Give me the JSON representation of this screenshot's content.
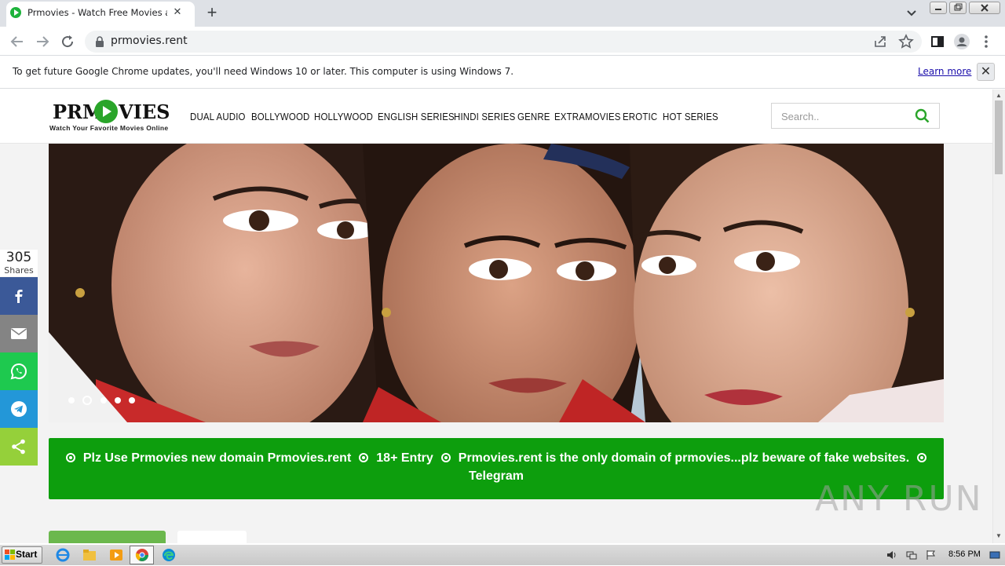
{
  "browser": {
    "tab_title": "Prmovies - Watch Free Movies and TV",
    "tab_close": "✕",
    "new_tab": "+",
    "url": "prmovies.rent",
    "infobar_text": "To get future Google Chrome updates, you'll need Windows 10 or later. This computer is using Windows 7.",
    "infobar_link": "Learn more",
    "infobar_close": "✕"
  },
  "site": {
    "logo_left": "PRM",
    "logo_right": "VIES",
    "tagline": "Watch Your Favorite Movies Online",
    "nav": [
      "DUAL AUDIO",
      "BOLLYWOOD",
      "HOLLYWOOD",
      "ENGLISH SERIES",
      "HINDI SERIES",
      "GENRE",
      "EXTRAMOVIES",
      "EROTIC",
      "HOT SERIES"
    ],
    "search_placeholder": "Search..",
    "accent_color": "#0d9e0d"
  },
  "share": {
    "count": "305",
    "label": "Shares",
    "buttons": [
      {
        "name": "facebook",
        "color": "#3b5998"
      },
      {
        "name": "email",
        "color": "#848484"
      },
      {
        "name": "whatsapp",
        "color": "#1ec94f"
      },
      {
        "name": "telegram",
        "color": "#2397d8"
      },
      {
        "name": "share",
        "color": "#95d03a"
      }
    ]
  },
  "slider": {
    "slide_count": 5,
    "active_index": 2
  },
  "notice": {
    "item1": "Plz Use Prmovies new domain Prmovies.rent",
    "item2": "18+ Entry",
    "item3": "Prmovies.rent is the only domain of prmovies...plz beware of fake websites.",
    "item4": "Telegram"
  },
  "watermark": "ANY RUN",
  "taskbar": {
    "start_label": "Start",
    "clock": "8:56 PM"
  }
}
